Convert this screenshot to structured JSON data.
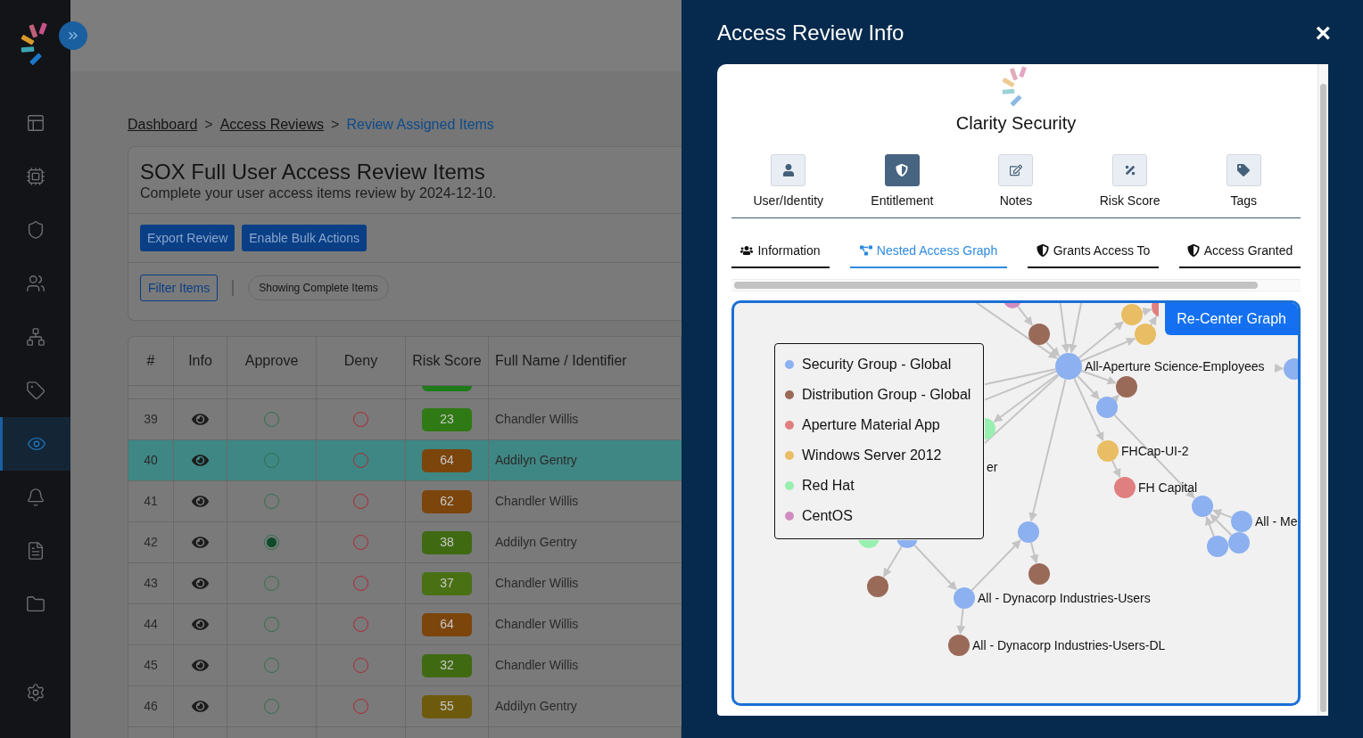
{
  "sidebar": {
    "items": [
      {
        "selected": false
      },
      {
        "selected": false
      },
      {
        "selected": false
      },
      {
        "selected": false
      },
      {
        "selected": false
      },
      {
        "selected": false
      },
      {
        "selected": true
      },
      {
        "selected": false
      },
      {
        "selected": false
      },
      {
        "selected": false
      }
    ]
  },
  "breadcrumb": [
    {
      "label": "Dashboard",
      "current": false
    },
    {
      "label": "Access Reviews",
      "current": false
    },
    {
      "label": "Review Assigned Items",
      "current": true
    }
  ],
  "breadcrumb_separator": ">",
  "review": {
    "title": "SOX Full User Access Review Items",
    "subtitle": "Complete your user access items review by 2024-12-10.",
    "buttons": [
      "Export Review",
      "Enable Bulk Actions"
    ],
    "filter_button": "Filter Items",
    "filter_chip": "Showing Complete Items"
  },
  "table": {
    "columns": [
      "#",
      "Info",
      "Approve",
      "Deny",
      "Risk Score",
      "Full Name / Identifier"
    ],
    "rows": [
      {
        "number": "39",
        "approve": false,
        "deny": false,
        "risk_score": "23",
        "color": "#2f7a14",
        "name": "Chandler Willis",
        "selected": false
      },
      {
        "number": "40",
        "approve": false,
        "deny": false,
        "risk_score": "64",
        "color": "#7c450c",
        "name": "Addilyn Gentry",
        "selected": true
      },
      {
        "number": "41",
        "approve": false,
        "deny": false,
        "risk_score": "62",
        "color": "#7c450c",
        "name": "Chandler Willis",
        "selected": false
      },
      {
        "number": "42",
        "approve": true,
        "deny": false,
        "risk_score": "38",
        "color": "#3f6a12",
        "name": "Addilyn Gentry",
        "selected": false
      },
      {
        "number": "43",
        "approve": false,
        "deny": false,
        "risk_score": "37",
        "color": "#4a7014",
        "name": "Chandler Willis",
        "selected": false
      },
      {
        "number": "44",
        "approve": false,
        "deny": false,
        "risk_score": "64",
        "color": "#7c450c",
        "name": "Chandler Willis",
        "selected": false
      },
      {
        "number": "45",
        "approve": false,
        "deny": false,
        "risk_score": "32",
        "color": "#3f6a12",
        "name": "Chandler Willis",
        "selected": false
      },
      {
        "number": "46",
        "approve": false,
        "deny": false,
        "risk_score": "55",
        "color": "#6e5a0c",
        "name": "Addilyn Gentry",
        "selected": false
      }
    ]
  },
  "drawer": {
    "title": "Access Review Info",
    "close": "×",
    "brand": "Clarity Security",
    "icon_tabs": [
      {
        "kind": "user",
        "label": "User/Identity",
        "selected": false
      },
      {
        "kind": "entitlement",
        "label": "Entitlement",
        "selected": true
      },
      {
        "kind": "notes",
        "label": "Notes",
        "selected": false
      },
      {
        "kind": "risk",
        "label": "Risk Score",
        "selected": false
      },
      {
        "kind": "tags",
        "label": "Tags",
        "selected": false
      }
    ],
    "sub_tabs": [
      {
        "kind": "users",
        "label": "Information",
        "selected": false
      },
      {
        "kind": "graph",
        "label": "Nested Access Graph",
        "selected": true
      },
      {
        "kind": "shield",
        "label": "Grants Access To",
        "selected": false
      },
      {
        "kind": "shield",
        "label": "Access Granted",
        "selected": false
      }
    ],
    "graph": {
      "recenter_button": "Re-Center Graph",
      "legend": [
        {
          "label": "Security Group - Global",
          "color": "#8cb0f0"
        },
        {
          "label": "Distribution Group - Global",
          "color": "#9a6a58"
        },
        {
          "label": "Aperture Material App",
          "color": "#e07f80"
        },
        {
          "label": "Windows Server 2012",
          "color": "#e8bd64"
        },
        {
          "label": "Red Hat",
          "color": "#98f0b0"
        },
        {
          "label": "CentOS",
          "color": "#d08cc0"
        }
      ],
      "node_labels": [
        "All-Aperture Science-Employees",
        "FHCap-UI-2",
        "FH Capital",
        "All - Me",
        "er",
        "All - Dynacorp Industries-Users",
        "All - Dynacorp Industries-Users-DL"
      ]
    }
  }
}
